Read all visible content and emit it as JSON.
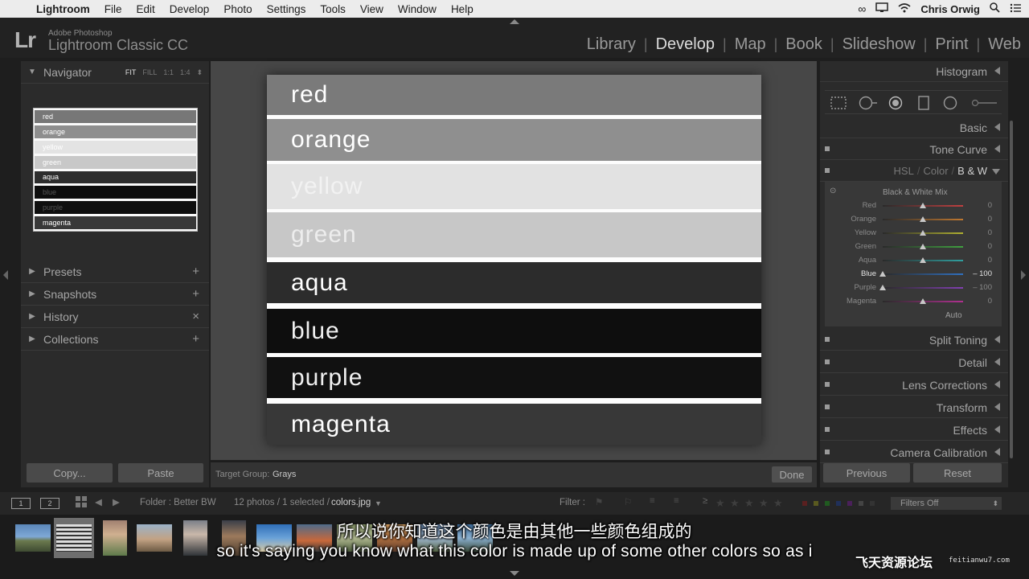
{
  "menubar": {
    "app": "Lightroom",
    "items": [
      "File",
      "Edit",
      "Develop",
      "Photo",
      "Settings",
      "Tools",
      "View",
      "Window",
      "Help"
    ],
    "user": "Chris Orwig"
  },
  "header": {
    "logo": "Lr",
    "brand_line1": "Adobe Photoshop",
    "brand_line2": "Lightroom Classic CC",
    "modules": [
      "Library",
      "Develop",
      "Map",
      "Book",
      "Slideshow",
      "Print",
      "Web"
    ],
    "active_module": "Develop"
  },
  "left_panel": {
    "navigator": {
      "title": "Navigator",
      "zoom": [
        "FIT",
        "FILL",
        "1:1",
        "1:4"
      ],
      "zoom_active": "FIT",
      "bands": [
        {
          "label": "red",
          "bg": "#777777",
          "fg": "#ffffff"
        },
        {
          "label": "orange",
          "bg": "#8e8e8e",
          "fg": "#ffffff"
        },
        {
          "label": "yellow",
          "bg": "#e3e3e3",
          "fg": "#ffffff"
        },
        {
          "label": "green",
          "bg": "#c8c8c8",
          "fg": "#ffffff"
        },
        {
          "label": "aqua",
          "bg": "#2d2d2d",
          "fg": "#ffffff"
        },
        {
          "label": "blue",
          "bg": "#0d0d0d",
          "fg": "#555555"
        },
        {
          "label": "purple",
          "bg": "#0f0f0f",
          "fg": "#555555"
        },
        {
          "label": "magenta",
          "bg": "#393939",
          "fg": "#ffffff"
        }
      ]
    },
    "sections": [
      {
        "title": "Presets",
        "action": "+"
      },
      {
        "title": "Snapshots",
        "action": "+"
      },
      {
        "title": "History",
        "action": "×"
      },
      {
        "title": "Collections",
        "action": "+"
      }
    ],
    "copy_label": "Copy...",
    "paste_label": "Paste"
  },
  "image": {
    "bands": [
      {
        "label": "red",
        "bg": "#7a7a7a",
        "fg": "#ffffff"
      },
      {
        "label": "orange",
        "bg": "#8f8f8f",
        "fg": "#ffffff"
      },
      {
        "label": "yellow",
        "bg": "#e2e2e2",
        "fg": "#f2f2f2"
      },
      {
        "label": "green",
        "bg": "#c7c7c7",
        "fg": "#ededed"
      },
      {
        "label": "aqua",
        "bg": "#2c2c2c",
        "fg": "#ffffff"
      },
      {
        "label": "blue",
        "bg": "#0e0e0e",
        "fg": "#f0f0f0"
      },
      {
        "label": "purple",
        "bg": "#111111",
        "fg": "#f0f0f0"
      },
      {
        "label": "magenta",
        "bg": "#383838",
        "fg": "#ffffff"
      }
    ]
  },
  "toolbar": {
    "target_group_label": "Target Group:",
    "target_group_value": "Grays",
    "done_label": "Done"
  },
  "right_panel": {
    "histogram": "Histogram",
    "basic": "Basic",
    "tone_curve": "Tone Curve",
    "hsl_tabs": [
      "HSL",
      "Color",
      "B & W"
    ],
    "hsl_active": "B & W",
    "bw_title": "Black & White Mix",
    "sliders": [
      {
        "label": "Red",
        "value": "0",
        "pos": 0.5,
        "color": "#c04040",
        "highlight": false
      },
      {
        "label": "Orange",
        "value": "0",
        "pos": 0.5,
        "color": "#c07830",
        "highlight": false
      },
      {
        "label": "Yellow",
        "value": "0",
        "pos": 0.5,
        "color": "#b0b030",
        "highlight": false
      },
      {
        "label": "Green",
        "value": "0",
        "pos": 0.5,
        "color": "#40a040",
        "highlight": false
      },
      {
        "label": "Aqua",
        "value": "0",
        "pos": 0.5,
        "color": "#30a0a0",
        "highlight": false
      },
      {
        "label": "Blue",
        "value": "– 100",
        "pos": 0.0,
        "color": "#3070c0",
        "highlight": true
      },
      {
        "label": "Purple",
        "value": "– 100",
        "pos": 0.0,
        "color": "#8040b0",
        "highlight": false
      },
      {
        "label": "Magenta",
        "value": "0",
        "pos": 0.5,
        "color": "#b03090",
        "highlight": false
      }
    ],
    "auto_label": "Auto",
    "sections": [
      "Split Toning",
      "Detail",
      "Lens Corrections",
      "Transform",
      "Effects",
      "Camera Calibration"
    ],
    "previous_label": "Previous",
    "reset_label": "Reset"
  },
  "filmstrip_bar": {
    "mon1": "1",
    "mon2": "2",
    "folder": "Folder : Better BW",
    "count": "12 photos / 1 selected /",
    "filename": "colors.jpg",
    "filter_label": "Filter :",
    "filters_off": "Filters Off"
  },
  "subtitles": {
    "zh": "所以说你知道这个颜色是由其他一些颜色组成的",
    "en": "so it's saying you know what this color is made up of some other colors so as i"
  },
  "watermark": {
    "text": "飞天资源论坛",
    "url": "feitianwu7.com"
  }
}
